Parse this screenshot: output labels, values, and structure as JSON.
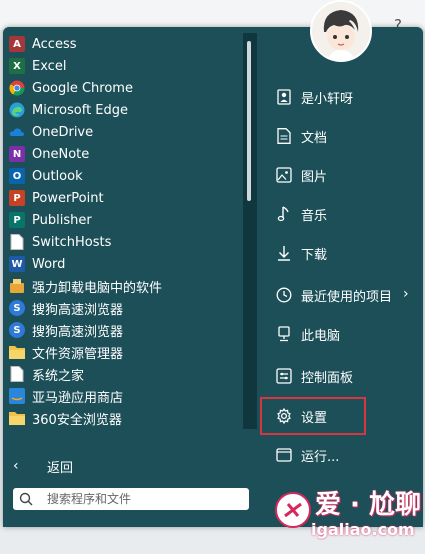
{
  "apps": [
    {
      "label": "Access",
      "icon": "access-icon",
      "color": "#a4373a",
      "glyph": "A"
    },
    {
      "label": "Excel",
      "icon": "excel-icon",
      "color": "#1d7044",
      "glyph": "X"
    },
    {
      "label": "Google Chrome",
      "icon": "chrome-icon",
      "color": "#e6b325",
      "glyph": ""
    },
    {
      "label": "Microsoft Edge",
      "icon": "edge-icon",
      "color": "#2aa0d8",
      "glyph": ""
    },
    {
      "label": "OneDrive",
      "icon": "onedrive-icon",
      "color": "#1683d8",
      "glyph": ""
    },
    {
      "label": "OneNote",
      "icon": "onenote-icon",
      "color": "#7b2fa8",
      "glyph": "N"
    },
    {
      "label": "Outlook",
      "icon": "outlook-icon",
      "color": "#0a64ad",
      "glyph": "O"
    },
    {
      "label": "PowerPoint",
      "icon": "powerpoint-icon",
      "color": "#c54324",
      "glyph": "P"
    },
    {
      "label": "Publisher",
      "icon": "publisher-icon",
      "color": "#077568",
      "glyph": "P"
    },
    {
      "label": "SwitchHosts",
      "icon": "file-icon",
      "color": "#ffffff",
      "glyph": ""
    },
    {
      "label": "Word",
      "icon": "word-icon",
      "color": "#1f5aa8",
      "glyph": "W"
    },
    {
      "label": "强力卸载电脑中的软件",
      "icon": "uninstall-icon",
      "color": "#e8a53a",
      "glyph": ""
    },
    {
      "label": "搜狗高速浏览器",
      "icon": "sogou-browser-icon",
      "color": "#2f79d8",
      "glyph": "S"
    },
    {
      "label": "搜狗高速浏览器",
      "icon": "sogou-browser-icon",
      "color": "#2f79d8",
      "glyph": "S"
    },
    {
      "label": "文件资源管理器",
      "icon": "folder-icon",
      "color": "#f2c34a",
      "glyph": ""
    },
    {
      "label": "系统之家",
      "icon": "file-icon",
      "color": "#ffffff",
      "glyph": ""
    },
    {
      "label": "亚马逊应用商店",
      "icon": "amazon-icon",
      "color": "#2a86d8",
      "glyph": ""
    },
    {
      "label": "360安全浏览器",
      "icon": "folder-icon",
      "color": "#f2c34a",
      "glyph": ""
    }
  ],
  "back": {
    "label": "返回"
  },
  "search": {
    "placeholder": "搜索程序和文件"
  },
  "right_pane": [
    {
      "label": "是小轩呀",
      "icon": "user-icon"
    },
    {
      "label": "文档",
      "icon": "document-icon"
    },
    {
      "label": "图片",
      "icon": "picture-icon"
    },
    {
      "label": "音乐",
      "icon": "music-icon"
    },
    {
      "label": "下载",
      "icon": "download-icon"
    },
    {
      "label": "最近使用的项目",
      "icon": "clock-icon",
      "has_submenu": true
    },
    {
      "label": "此电脑",
      "icon": "computer-icon"
    },
    {
      "label": "控制面板",
      "icon": "control-panel-icon"
    },
    {
      "label": "设置",
      "icon": "gear-icon"
    },
    {
      "label": "运行...",
      "icon": "run-icon"
    }
  ],
  "watermark": {
    "title": "爱 · 尬聊",
    "url": "igaliao.com"
  },
  "colors": {
    "menu_bg": "#1d4f58",
    "highlight": "#d6373f"
  }
}
